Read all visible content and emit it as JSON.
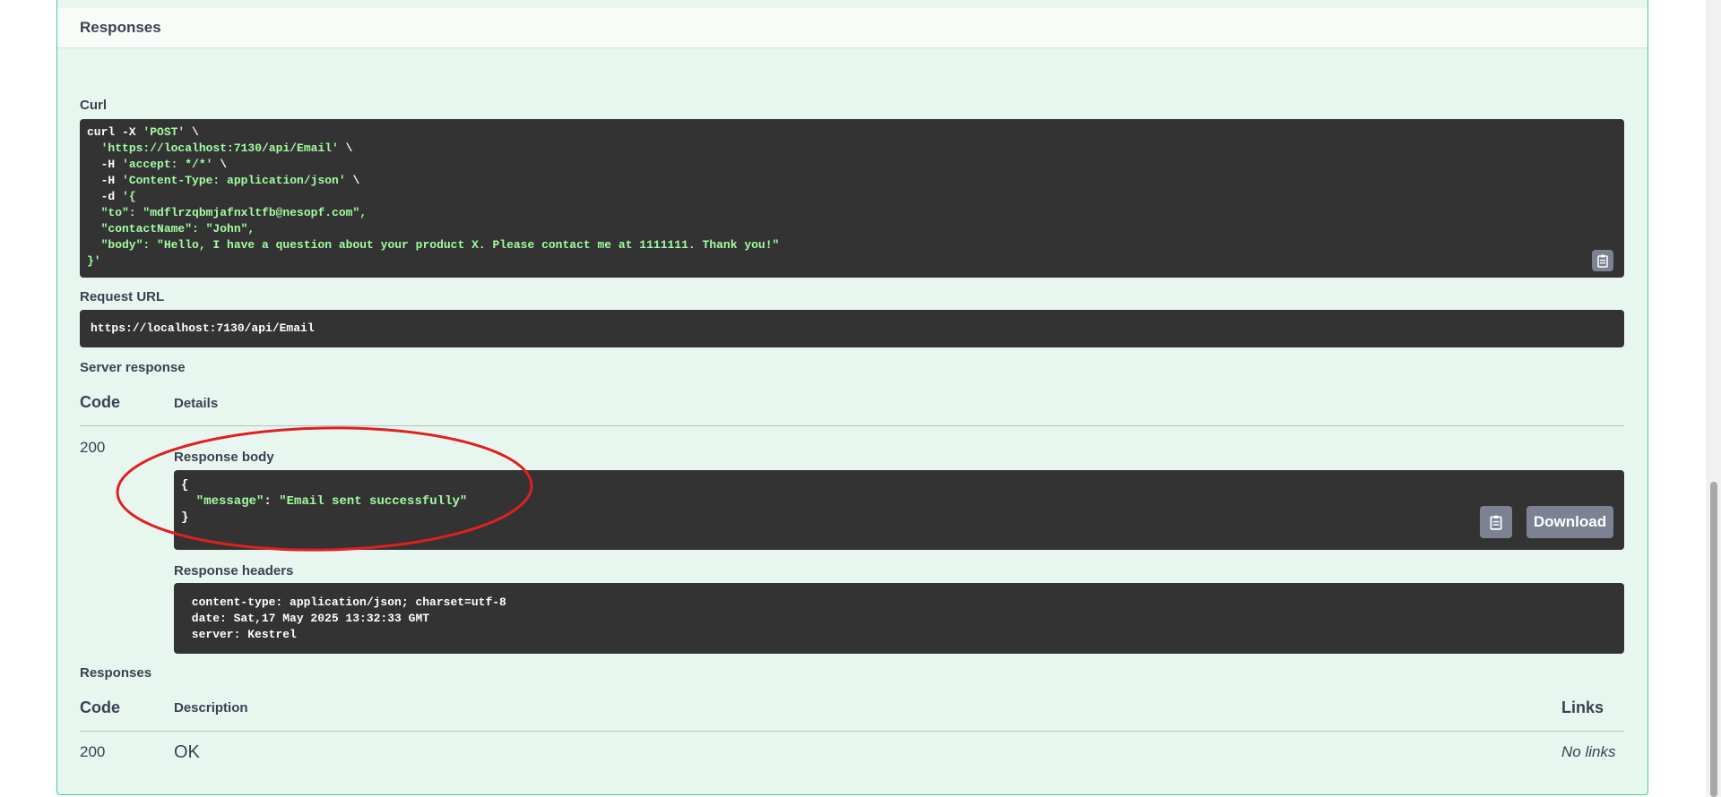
{
  "section": {
    "title": "Responses"
  },
  "curl": {
    "label": "Curl",
    "lines": [
      [
        {
          "t": "curl -X "
        },
        {
          "t": "'POST'",
          "c": "str"
        },
        {
          "t": " \\"
        }
      ],
      [
        {
          "t": "  "
        },
        {
          "t": "'https://localhost:7130/api/Email'",
          "c": "str"
        },
        {
          "t": " \\"
        }
      ],
      [
        {
          "t": "  -H "
        },
        {
          "t": "'accept: */*'",
          "c": "str"
        },
        {
          "t": " \\"
        }
      ],
      [
        {
          "t": "  -H "
        },
        {
          "t": "'Content-Type: application/json'",
          "c": "str"
        },
        {
          "t": " \\"
        }
      ],
      [
        {
          "t": "  -d "
        },
        {
          "t": "'{",
          "c": "str"
        }
      ],
      [
        {
          "t": "  \"to\": \"mdflrzqbmjafnxltfb@nesopf.com\",",
          "c": "str"
        }
      ],
      [
        {
          "t": "  \"contactName\": \"John\",",
          "c": "str"
        }
      ],
      [
        {
          "t": "  \"body\": \"Hello, I have a question about your product X. Please contact me at 1111111. Thank you!\"",
          "c": "str"
        }
      ],
      [
        {
          "t": "}'",
          "c": "str"
        }
      ]
    ]
  },
  "request_url": {
    "label": "Request URL",
    "value": "https://localhost:7130/api/Email"
  },
  "server_response": {
    "label": "Server response",
    "col_code": "Code",
    "col_details": "Details",
    "code": "200",
    "body_label": "Response body",
    "body_lines": [
      [
        {
          "t": "{"
        }
      ],
      [
        {
          "t": "  \"message\"",
          "c": "key"
        },
        {
          "t": ": "
        },
        {
          "t": "\"Email sent successfully\"",
          "c": "str"
        }
      ],
      [
        {
          "t": "}"
        }
      ]
    ],
    "download_label": "Download",
    "headers_label": "Response headers",
    "headers_lines": [
      " content-type: application/json; charset=utf-8 ",
      " date: Sat,17 May 2025 13:32:33 GMT ",
      " server: Kestrel "
    ]
  },
  "responses": {
    "label": "Responses",
    "col_code": "Code",
    "col_description": "Description",
    "col_links": "Links",
    "rows": [
      {
        "code": "200",
        "description": "OK",
        "links": "No links"
      }
    ]
  },
  "colors": {
    "accent": "#49cc90",
    "panel_bg": "#e8f6f0",
    "code_bg": "#333333",
    "annotation": "#e02020"
  },
  "icons": {
    "copy": "clipboard-icon"
  }
}
